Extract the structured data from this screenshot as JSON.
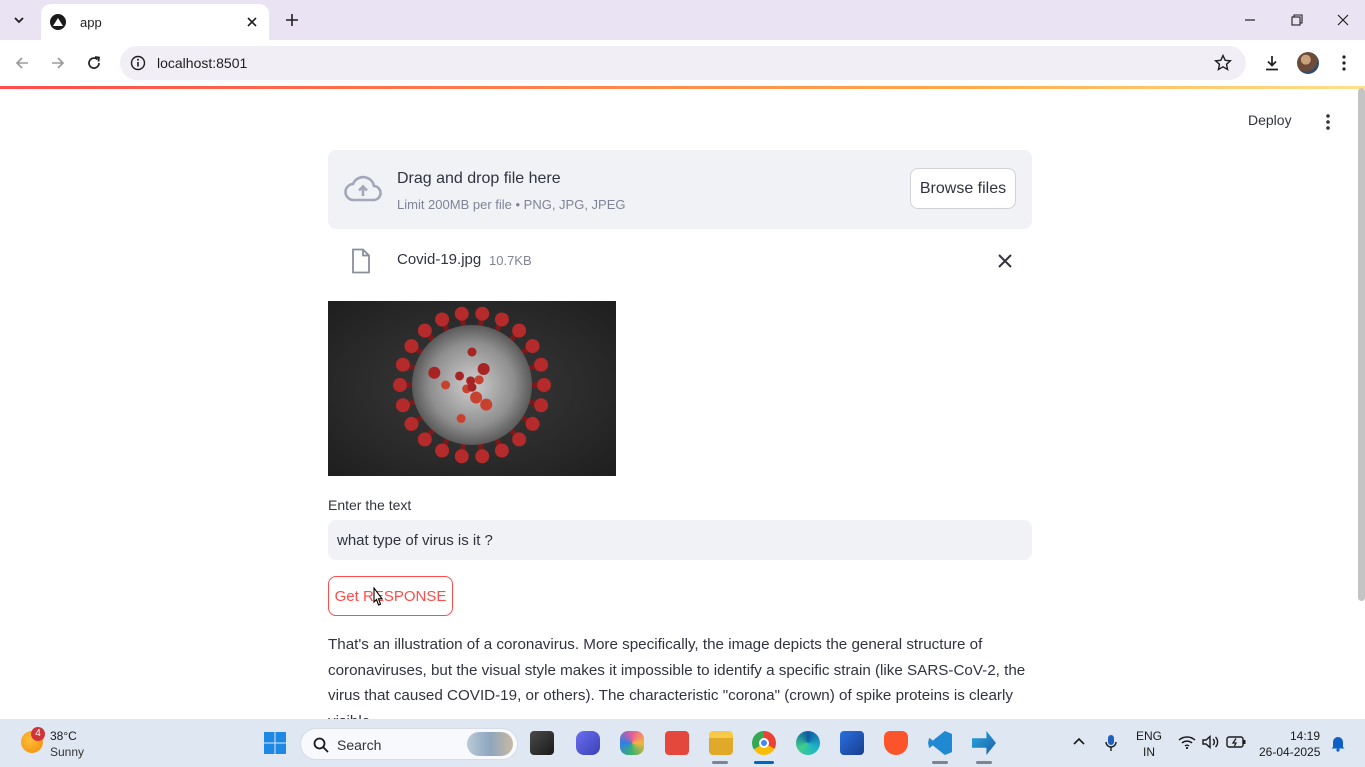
{
  "browser": {
    "tab_title": "app",
    "url": "localhost:8501"
  },
  "app": {
    "deploy_label": "Deploy",
    "uploader": {
      "title": "Drag and drop file here",
      "subtitle": "Limit 200MB per file • PNG, JPG, JPEG",
      "browse_label": "Browse files"
    },
    "file": {
      "name": "Covid-19.jpg",
      "size": "10.7KB"
    },
    "input": {
      "label": "Enter the text",
      "value": "what type of virus is it ?"
    },
    "button_label": "Get RESPONSE",
    "response_text": "That's an illustration of a coronavirus. More specifically, the image depicts the general structure of coronaviruses, but the visual style makes it impossible to identify a specific strain (like SARS-CoV-2, the virus that caused COVID-19, or others). The characteristic \"corona\" (crown) of spike proteins is clearly visible."
  },
  "taskbar": {
    "weather_badge": "4",
    "weather_temp": "38°C",
    "weather_condition": "Sunny",
    "search_placeholder": "Search",
    "language": "ENG",
    "region": "IN",
    "time": "14:19",
    "date": "26-04-2025"
  },
  "colors": {
    "accent": "#ff4b4b",
    "chrome_frame": "#e9e3f4",
    "input_bg": "#f0f2f6",
    "text": "#31333f",
    "muted_text": "#808495"
  }
}
